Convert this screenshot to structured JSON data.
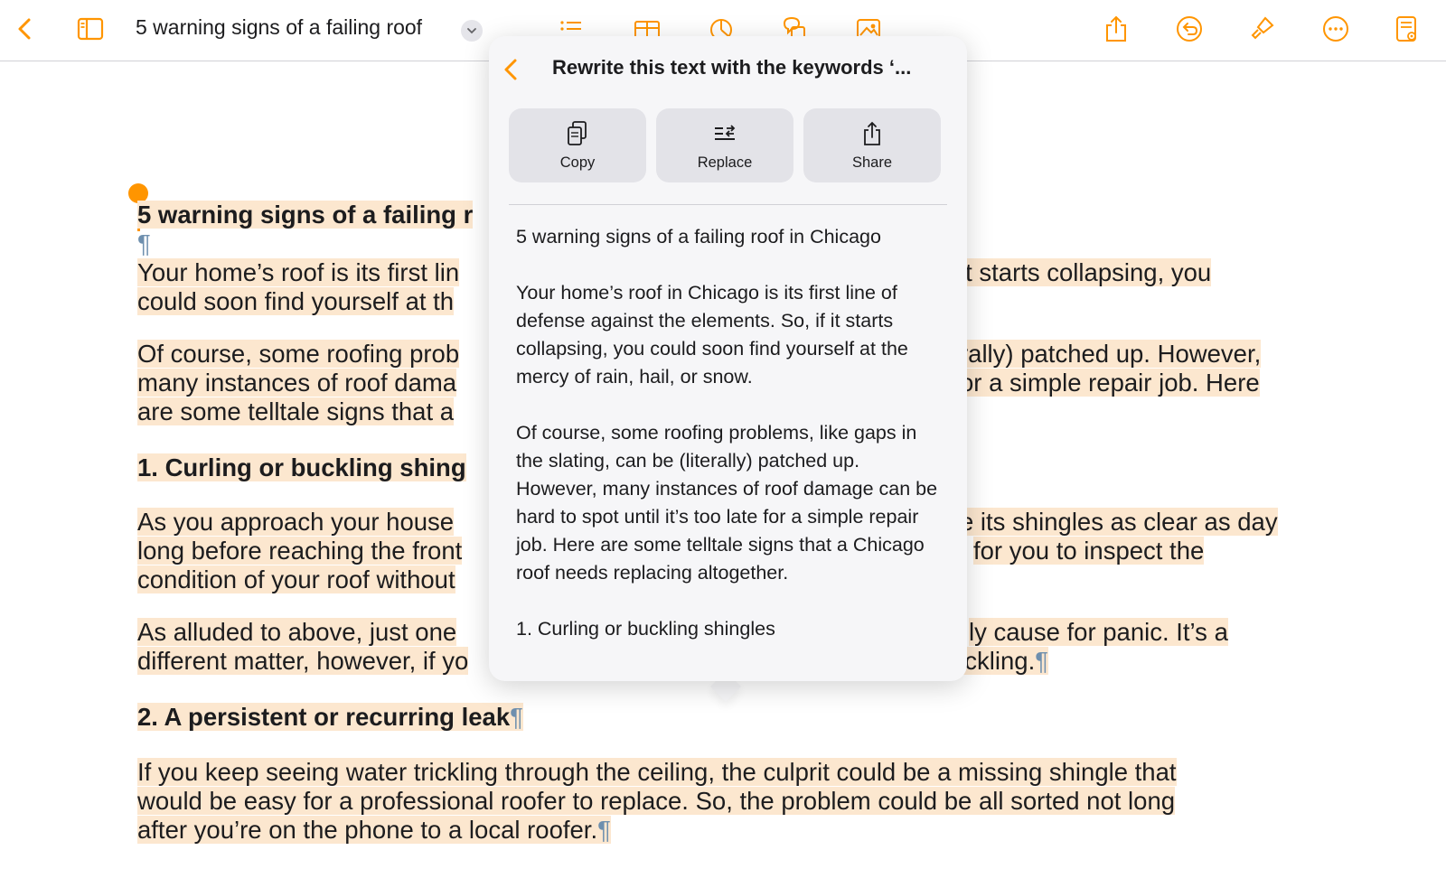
{
  "toolbar": {
    "title": "5 warning signs of a failing roof",
    "accent": "#ff9500",
    "icons": [
      "back-chevron-icon",
      "sidebar-icon",
      "chevron-down-icon",
      "list-icon",
      "table-icon",
      "chart-icon",
      "shapes-icon",
      "media-icon",
      "share-icon",
      "undo-icon",
      "paintbrush-icon",
      "more-icon",
      "document-view-icon"
    ]
  },
  "document": {
    "title": "5 warning signs of a failing r",
    "pilcrow": "¶",
    "p1_left_1": "Your home’s roof is its first lin",
    "p1_right_1": "it starts collapsing, you",
    "p1_left_2": "could soon find yourself at th",
    "p2_left_1": "Of course, some roofing prob",
    "p2_right_1": "rally) patched up. However,",
    "p2_left_2": "many instances of roof dama",
    "p2_right_2": "or a simple repair job. Here",
    "p2_left_3": "are some telltale signs that a",
    "h1_left": "1. Curling or buckling shing",
    "p3_left_1": "As you approach your house",
    "p3_right_1": "e its shingles as clear as day",
    "p3_left_2": "long before reaching the front",
    "p3_right_2": "for you to inspect the",
    "p3_left_3": "condition of your roof without",
    "p4_left_1": "As alluded to above, just one",
    "p4_right_1": "ly cause for panic. It’s a",
    "p4_left_2": "different matter, however, if yo",
    "p4_right_2": "uckling.",
    "h2": "2. A persistent or recurring leak",
    "p5_1": "If you keep seeing water trickling through the ceiling, the culprit could be a missing shingle that",
    "p5_2": "would be easy for a professional roofer to replace. So, the problem could be all sorted not long",
    "p5_3": "after you’re on the phone to a local roofer.",
    "highlight_color": "#fce7cf"
  },
  "popover": {
    "title": "Rewrite this text with the keywords ‘...",
    "buttons": [
      {
        "label": "Copy",
        "icon": "copy-icon"
      },
      {
        "label": "Replace",
        "icon": "replace-icon"
      },
      {
        "label": "Share",
        "icon": "share-icon"
      }
    ],
    "content": {
      "title": "5 warning signs of a failing roof in Chicago",
      "para1": "Your home’s roof in Chicago is its first line of defense against the elements. So, if it starts collapsing, you could soon find yourself at the mercy of rain, hail, or snow.",
      "para2": "Of course, some roofing problems, like gaps in the slating, can be (literally) patched up. However, many instances of roof damage can be hard to spot until it’s too late for a simple repair job. Here are some telltale signs that a Chicago roof needs replacing altogether.",
      "heading1": "1. Curling or buckling shingles"
    }
  }
}
